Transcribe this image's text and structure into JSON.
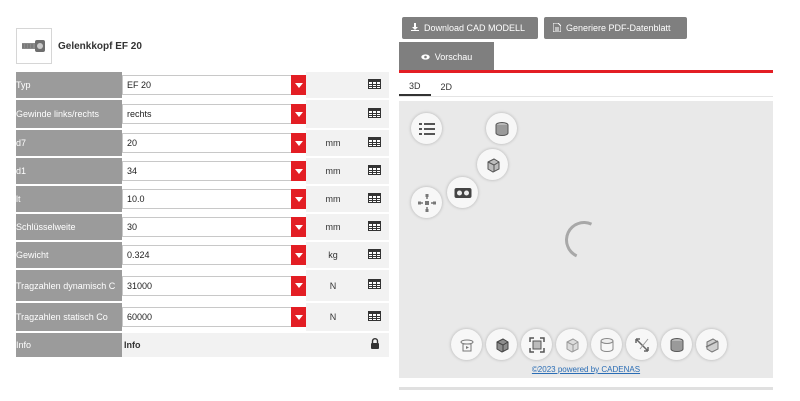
{
  "product": {
    "title": "Gelenkkopf EF 20",
    "thumbnail_icon": "rod-end-thumbnail"
  },
  "rows": [
    {
      "label": "Typ",
      "value": "EF 20",
      "unit": "",
      "tool_icon": "table-icon",
      "type": "select"
    },
    {
      "label": "Gewinde links/rechts",
      "value": "rechts",
      "unit": "",
      "tool_icon": "table-icon",
      "type": "select"
    },
    {
      "label": "d7",
      "value": "20",
      "unit": "mm",
      "tool_icon": "table-icon",
      "type": "select"
    },
    {
      "label": "d1",
      "value": "34",
      "unit": "mm",
      "tool_icon": "table-icon",
      "type": "select"
    },
    {
      "label": "lt",
      "value": "10.0",
      "unit": "mm",
      "tool_icon": "table-icon",
      "type": "select"
    },
    {
      "label": "Schlüsselweite",
      "value": "30",
      "unit": "mm",
      "tool_icon": "table-icon",
      "type": "select"
    },
    {
      "label": "Gewicht",
      "value": "0.324",
      "unit": "kg",
      "tool_icon": "table-icon",
      "type": "select"
    },
    {
      "label": "Tragzahlen dynamisch C",
      "value": "31000",
      "unit": "N",
      "tool_icon": "table-icon",
      "type": "select"
    },
    {
      "label": "Tragzahlen statisch Co",
      "value": "60000",
      "unit": "N",
      "tool_icon": "table-icon",
      "type": "select"
    },
    {
      "label": "Info",
      "value": "Info",
      "unit": "",
      "tool_icon": "lock-icon",
      "type": "info"
    }
  ],
  "toolbar": {
    "download_label": "Download CAD MODELL",
    "pdf_label": "Generiere PDF-Datenblatt"
  },
  "preview": {
    "tab_label": "Vorschau",
    "subtabs": [
      "3D",
      "2D"
    ],
    "active_subtab": "3D",
    "powered_by": "©2023 powered by CADENAS"
  },
  "colors": {
    "accent_red": "#e31e24",
    "label_gray": "#9b9b9b",
    "button_gray": "#7f7f7f",
    "link_blue": "#2a6db5"
  }
}
